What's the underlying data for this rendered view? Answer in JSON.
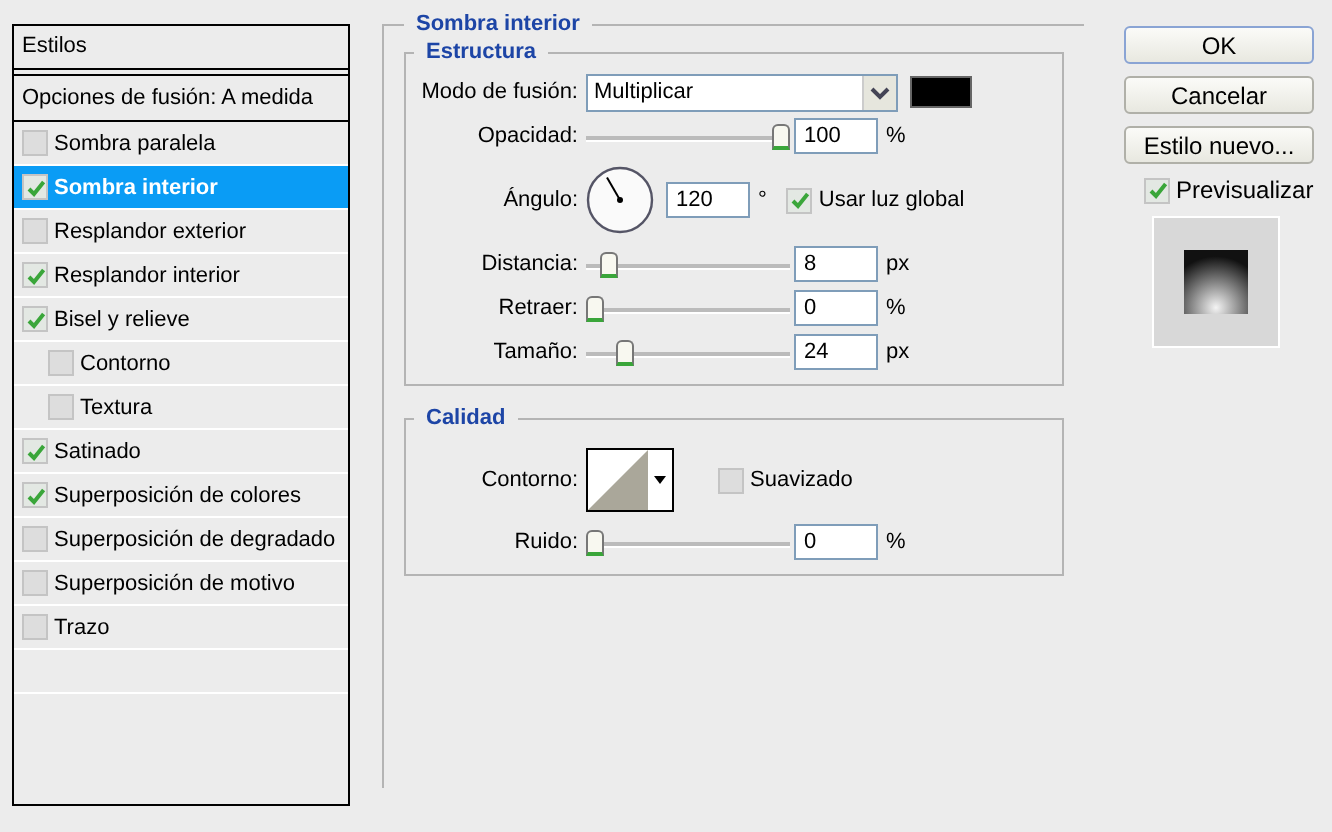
{
  "styles_panel": {
    "header": "Estilos",
    "blend_options": "Opciones de fusión: A medida",
    "items": [
      {
        "label": "Sombra paralela",
        "checked": false,
        "selected": false
      },
      {
        "label": "Sombra interior",
        "checked": true,
        "selected": true
      },
      {
        "label": "Resplandor exterior",
        "checked": false,
        "selected": false
      },
      {
        "label": "Resplandor interior",
        "checked": true,
        "selected": false
      },
      {
        "label": "Bisel y relieve",
        "checked": true,
        "selected": false,
        "children": [
          {
            "label": "Contorno",
            "checked": false,
            "selected": false
          },
          {
            "label": "Textura",
            "checked": false,
            "selected": false
          }
        ]
      },
      {
        "label": "Satinado",
        "checked": true,
        "selected": false
      },
      {
        "label": "Superposición de colores",
        "checked": true,
        "selected": false
      },
      {
        "label": "Superposición de degradado",
        "checked": false,
        "selected": false
      },
      {
        "label": "Superposición de motivo",
        "checked": false,
        "selected": false
      },
      {
        "label": "Trazo",
        "checked": false,
        "selected": false
      }
    ]
  },
  "section_title": "Sombra interior",
  "structure": {
    "title": "Estructura",
    "blend_mode_label": "Modo de fusión:",
    "blend_mode": "Multiplicar",
    "color": "#000000",
    "opacity": {
      "label": "Opacidad:",
      "level": 1.0,
      "value": "100",
      "unit": "%"
    },
    "angle": {
      "label": "Ángulo:",
      "value": "120",
      "unit": "°",
      "global_light": {
        "label": "Usar luz global",
        "checked": true
      }
    },
    "sliders": [
      {
        "label": "Distancia:",
        "level": 0.08,
        "value": "8",
        "unit": "px"
      },
      {
        "label": "Retraer:",
        "level": 0.0,
        "value": "0",
        "unit": "%"
      },
      {
        "label": "Tamaño:",
        "level": 0.16,
        "value": "24",
        "unit": "px"
      }
    ]
  },
  "quality": {
    "title": "Calidad",
    "contour_label": "Contorno:",
    "antialias": {
      "label": "Suavizado",
      "checked": false
    },
    "noise": {
      "label": "Ruido:",
      "level": 0.0,
      "value": "0",
      "unit": "%"
    }
  },
  "buttons": [
    {
      "label": "OK",
      "default": true
    },
    {
      "label": "Cancelar",
      "default": false
    },
    {
      "label": "Estilo nuevo...",
      "default": false
    }
  ],
  "preview": {
    "label": "Previsualizar",
    "checked": true
  }
}
